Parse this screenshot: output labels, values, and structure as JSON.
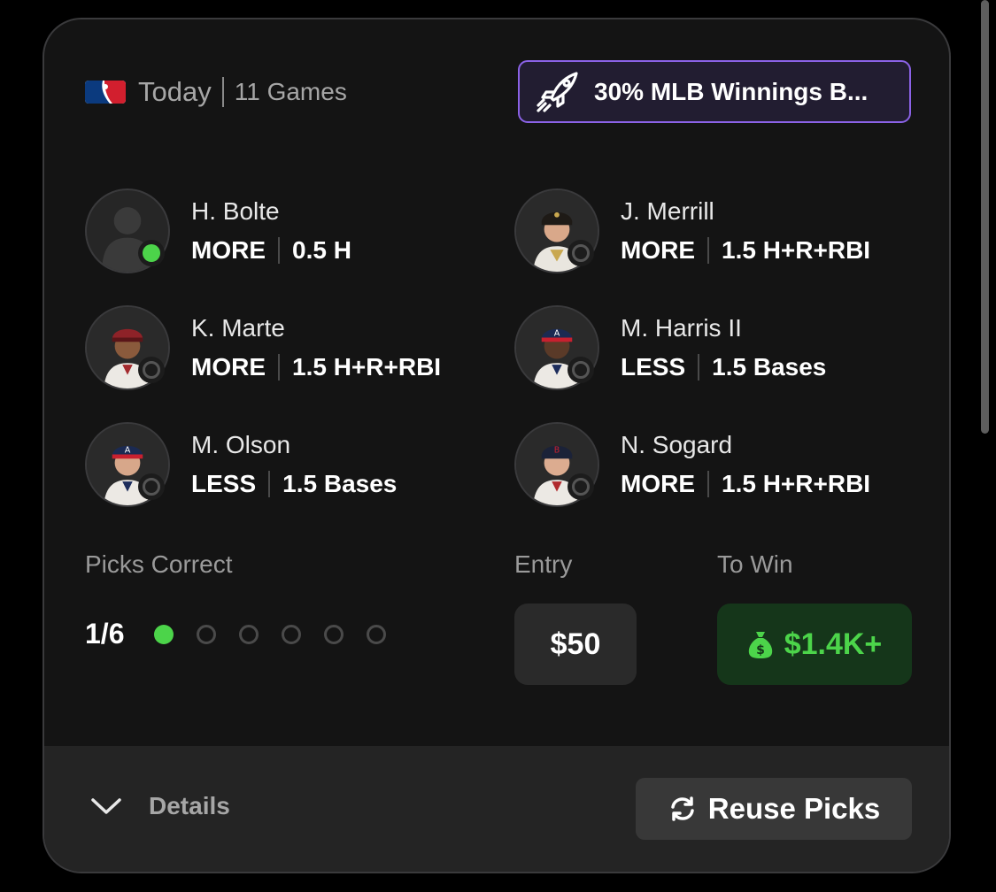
{
  "header": {
    "league_icon": "mlb-logo",
    "day": "Today",
    "games": "11 Games",
    "promo_icon": "rocket-icon",
    "promo_text": "30% MLB Winnings B..."
  },
  "picks": [
    {
      "name": "H. Bolte",
      "direction": "MORE",
      "line": "0.5 H",
      "status": "hit"
    },
    {
      "name": "J. Merrill",
      "direction": "MORE",
      "line": "1.5 H+R+RBI",
      "status": "pending"
    },
    {
      "name": "K. Marte",
      "direction": "MORE",
      "line": "1.5 H+R+RBI",
      "status": "pending"
    },
    {
      "name": "M. Harris II",
      "direction": "LESS",
      "line": "1.5 Bases",
      "status": "pending"
    },
    {
      "name": "M. Olson",
      "direction": "LESS",
      "line": "1.5 Bases",
      "status": "pending"
    },
    {
      "name": "N. Sogard",
      "direction": "MORE",
      "line": "1.5 H+R+RBI",
      "status": "pending"
    }
  ],
  "stats": {
    "picks_correct_label": "Picks Correct",
    "picks_correct_value": "1/6",
    "correct_count": 1,
    "total_count": 6,
    "entry_label": "Entry",
    "entry_value": "$50",
    "to_win_label": "To Win",
    "to_win_value": "$1.4K+",
    "to_win_icon": "money-bag-icon"
  },
  "footer": {
    "details_label": "Details",
    "reuse_label": "Reuse Picks"
  },
  "colors": {
    "accent_green": "#4cd44a",
    "promo_border": "#8b62e6"
  }
}
